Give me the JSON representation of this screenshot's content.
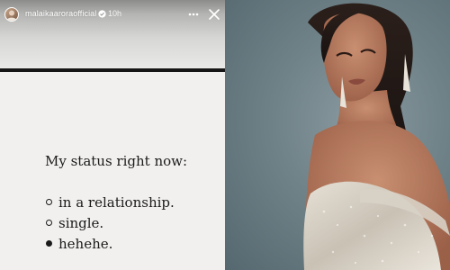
{
  "story": {
    "username": "malaikaaroraofficial",
    "timestamp": "10h",
    "status": {
      "title": "My status right now:",
      "options": [
        {
          "label": "in a relationship.",
          "selected": false
        },
        {
          "label": "single.",
          "selected": false
        },
        {
          "label": "hehehe.",
          "selected": true
        }
      ]
    }
  },
  "icons": {
    "avatar": "profile-avatar",
    "verified": "verified-badge-icon",
    "more": "more-options-icon",
    "close": "close-icon"
  },
  "colors": {
    "story_background": "#f1f0ee",
    "divider": "#161616",
    "photo_background": "#6f8288",
    "dress": "#d8d1c6"
  }
}
